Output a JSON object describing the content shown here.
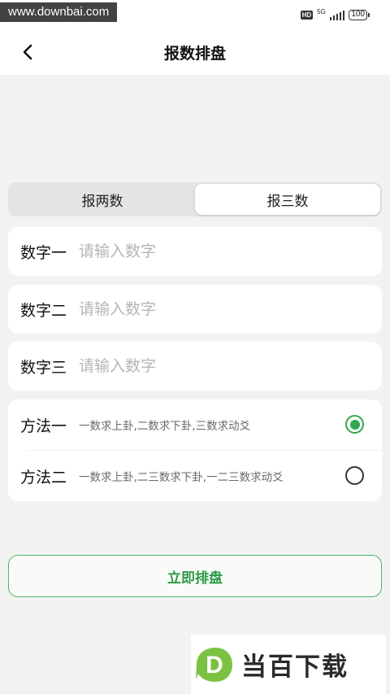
{
  "status_bar": {
    "watermark_url": "www.downbai.com",
    "hd": "HD",
    "network": "5G",
    "battery": "100"
  },
  "nav": {
    "title": "报数排盘"
  },
  "segment": {
    "tabs": [
      "报两数",
      "报三数"
    ],
    "selected": "报三数"
  },
  "inputs": [
    {
      "label": "数字一",
      "placeholder": "请输入数字",
      "value": ""
    },
    {
      "label": "数字二",
      "placeholder": "请输入数字",
      "value": ""
    },
    {
      "label": "数字三",
      "placeholder": "请输入数字",
      "value": ""
    }
  ],
  "methods": [
    {
      "label": "方法一",
      "desc": "一数求上卦,二数求下卦,三数求动爻",
      "checked": true
    },
    {
      "label": "方法二",
      "desc": "一数求上卦,二三数求下卦,一二三数求动爻",
      "checked": false
    }
  ],
  "submit_label": "立即排盘",
  "site_logo": {
    "letter": "D",
    "text": "当百下载"
  },
  "colors": {
    "accent": "#2fa84f",
    "background": "#f2f2f2"
  }
}
